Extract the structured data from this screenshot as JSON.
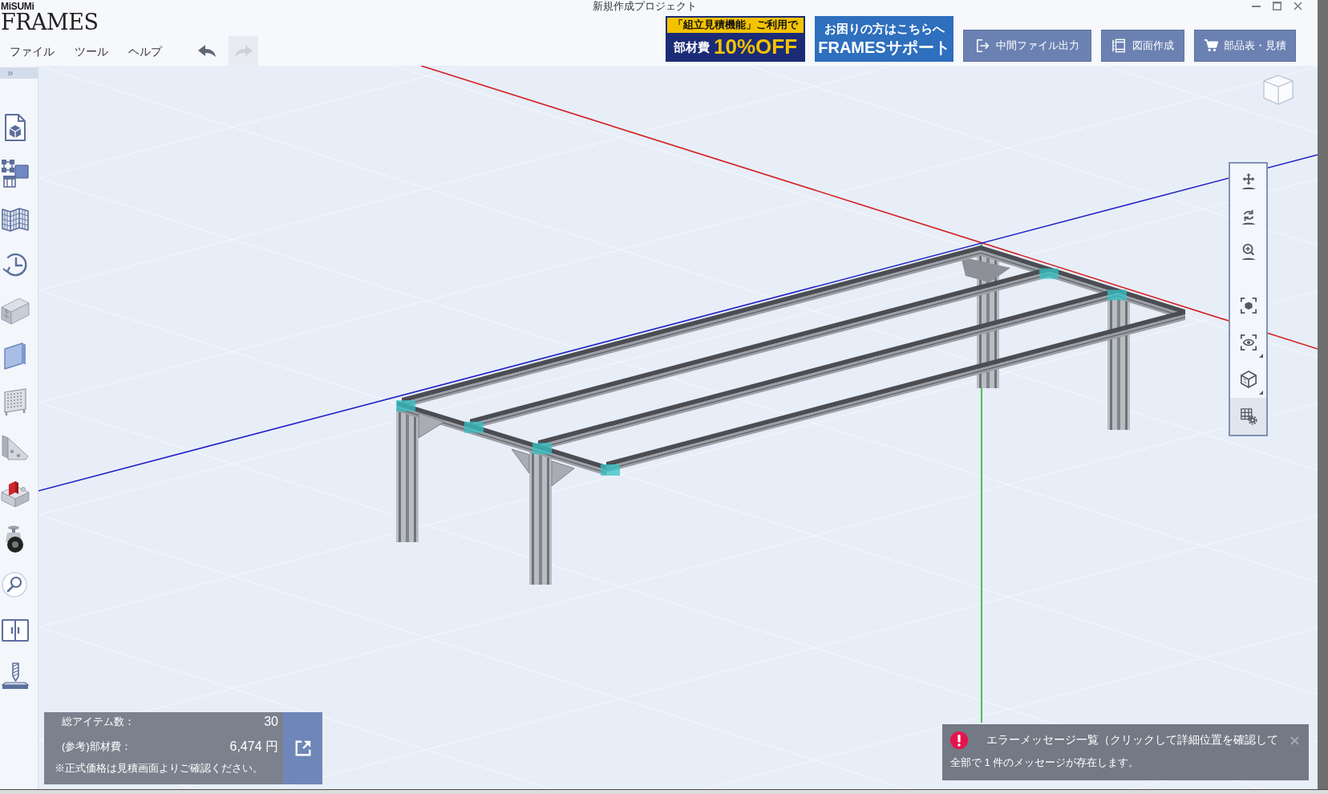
{
  "window": {
    "brand": "MiSUMi",
    "product": "FRAMES",
    "title": "新規作成プロジェクト"
  },
  "menu": [
    {
      "label": "ファイル"
    },
    {
      "label": "ツール"
    },
    {
      "label": "ヘルプ"
    }
  ],
  "history": [
    {
      "disabled": false
    },
    {
      "disabled": true
    }
  ],
  "banners": [
    {
      "kind": "discount",
      "caption": "「組立見積機能」ご利用で",
      "label": "部材費",
      "highlight": "10%OFF"
    },
    {
      "kind": "support",
      "line_1": "お困りの方はこちらへ",
      "line_2": "FRAMESサポート"
    }
  ],
  "actions": [
    {
      "label": "中間ファイル出力"
    },
    {
      "label": "図面作成"
    },
    {
      "label": "部品表・見積"
    }
  ],
  "sidebar": {
    "toggle": "»"
  },
  "view_tool_groups": [
    {
      "tools": [
        {
          "selected": false,
          "submenu": false
        },
        {
          "selected": false,
          "submenu": false
        },
        {
          "selected": false,
          "submenu": false
        }
      ]
    },
    {
      "tools": [
        {
          "selected": false,
          "submenu": false
        },
        {
          "selected": false,
          "submenu": true
        },
        {
          "selected": false,
          "submenu": true
        },
        {
          "selected": true,
          "submenu": false
        }
      ]
    }
  ],
  "summary_panel": {
    "rows": [
      {
        "label": "総アイテム数：",
        "value": "30"
      },
      {
        "label": "(参考)部材費：",
        "value": "6,474 円"
      }
    ],
    "note": "※正式価格は見積画面よりご確認ください。"
  },
  "error_panel": {
    "title": "エラーメッセージ一覧（クリックして詳細位置を確認して",
    "summary": "全部で 1 件のメッセージが存在します。"
  }
}
